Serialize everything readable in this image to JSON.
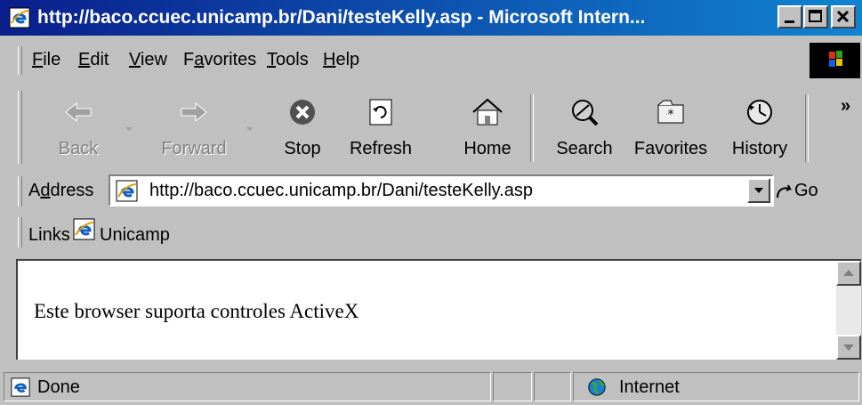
{
  "window": {
    "title": "http://baco.ccuec.unicamp.br/Dani/testeKelly.asp - Microsoft Intern...",
    "buttons": [
      "minimize",
      "maximize",
      "close"
    ]
  },
  "menu": {
    "items": [
      {
        "label": "File",
        "accel": "F",
        "rest": "ile"
      },
      {
        "label": "Edit",
        "accel": "E",
        "rest": "dit"
      },
      {
        "label": "View",
        "accel": "V",
        "rest": "iew"
      },
      {
        "label": "Favorites",
        "pre": "F",
        "accel": "a",
        "rest": "vorites"
      },
      {
        "label": "Tools",
        "accel": "T",
        "rest": "ools"
      },
      {
        "label": "Help",
        "accel": "H",
        "rest": "elp"
      }
    ]
  },
  "toolbar": {
    "back": "Back",
    "forward": "Forward",
    "stop": "Stop",
    "refresh": "Refresh",
    "home": "Home",
    "search": "Search",
    "favorites": "Favorites",
    "history": "History",
    "more": "»"
  },
  "address": {
    "label": "Address",
    "value": "http://baco.ccuec.unicamp.br/Dani/testeKelly.asp",
    "go": "Go"
  },
  "links": {
    "label": "Links",
    "items": [
      "Unicamp"
    ]
  },
  "content": {
    "text": "Este browser suporta controles ActiveX"
  },
  "status": {
    "text": "Done",
    "zone": "Internet"
  }
}
